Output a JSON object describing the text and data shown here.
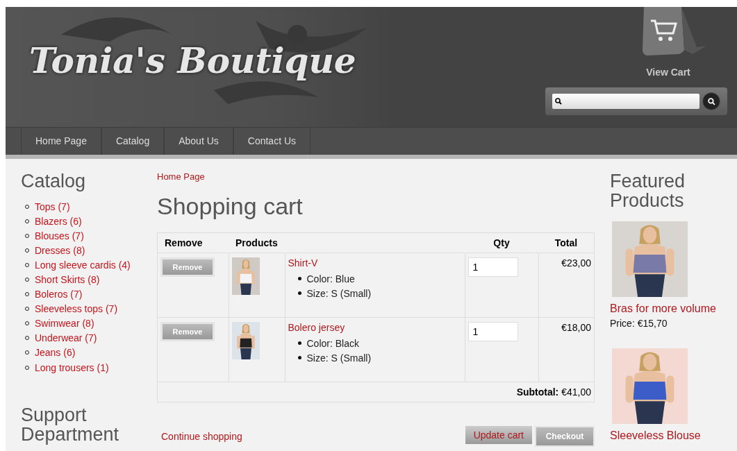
{
  "header": {
    "logo": "Tonia's Boutique",
    "view_cart": "View Cart"
  },
  "nav": [
    {
      "label": "Home Page"
    },
    {
      "label": "Catalog"
    },
    {
      "label": "About Us"
    },
    {
      "label": "Contact Us"
    }
  ],
  "catalog": {
    "title": "Catalog",
    "items": [
      {
        "label": "Tops (7)"
      },
      {
        "label": "Blazers (6)"
      },
      {
        "label": "Blouses (7)"
      },
      {
        "label": "Dresses (8)"
      },
      {
        "label": "Long sleeve cardis (4)"
      },
      {
        "label": "Short Skirts (8)"
      },
      {
        "label": "Boleros (7)"
      },
      {
        "label": "Sleeveless tops (7)"
      },
      {
        "label": "Swimwear (8)"
      },
      {
        "label": "Underwear (7)"
      },
      {
        "label": "Jeans (6)"
      },
      {
        "label": "Long trousers (1)"
      }
    ]
  },
  "support": {
    "title": "Support Department"
  },
  "breadcrumb": "Home Page",
  "page_title": "Shopping cart",
  "cart": {
    "columns": [
      "Remove",
      "Products",
      "Qty",
      "Total"
    ],
    "rows": [
      {
        "remove": "Remove",
        "name": "Shirt-V",
        "attributes": [
          "Color: Blue",
          "Size: S (Small)"
        ],
        "qty": "1",
        "total": "€23,00"
      },
      {
        "remove": "Remove",
        "name": "Bolero jersey",
        "attributes": [
          "Color: Black",
          "Size: S (Small)"
        ],
        "qty": "1",
        "total": "€18,00"
      }
    ],
    "subtotal_label": "Subtotal:",
    "subtotal": "€41,00"
  },
  "actions": {
    "continue": "Continue shopping",
    "update": "Update cart",
    "checkout": "Checkout"
  },
  "featured": {
    "title": "Featured Products",
    "items": [
      {
        "kind": "picture",
        "name": "Bras for more volume",
        "price": "Price: €15,70"
      },
      {
        "kind": "picture",
        "name": "Sleeveless Blouse"
      }
    ]
  }
}
